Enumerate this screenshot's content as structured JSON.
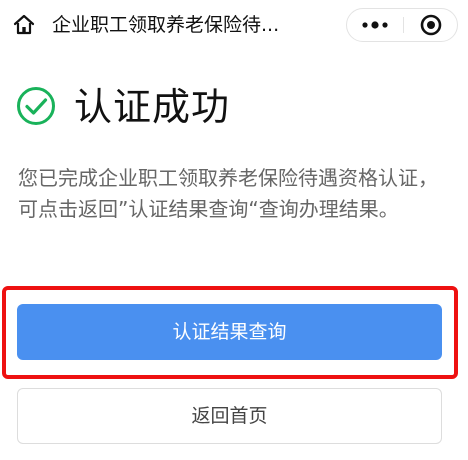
{
  "nav": {
    "title": "企业职工领取养老保险待...",
    "home_icon": "home-icon",
    "more_icon": "more-dots-icon",
    "close_icon": "target-close-icon"
  },
  "result": {
    "icon": "check-circle-icon",
    "title": "认证成功",
    "description": "您已完成企业职工领取养老保险待遇资格认证，可点击返回”认证结果查询“查询办理结果。"
  },
  "actions": {
    "primary_label": "认证结果查询",
    "secondary_label": "返回首页"
  },
  "colors": {
    "success_green": "#19b25a",
    "primary_blue": "#4a90f0",
    "highlight_red": "#ee1111",
    "text_gray": "#666666"
  }
}
